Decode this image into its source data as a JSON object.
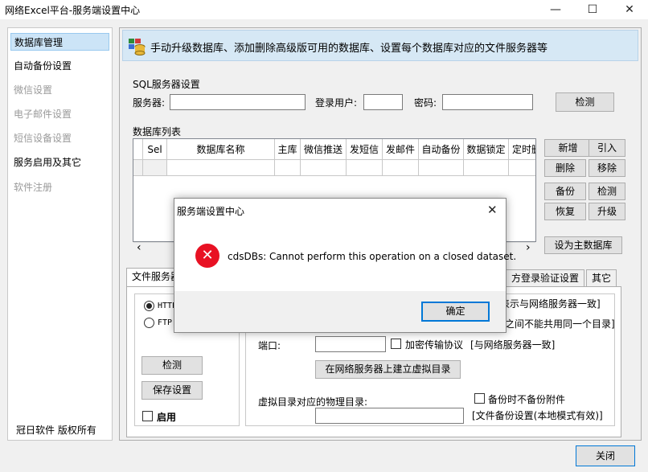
{
  "window": {
    "title": "网络Excel平台-服务端设置中心",
    "minimize": "—",
    "maximize": "☐",
    "close": "✕"
  },
  "sidebar": {
    "items": [
      {
        "label": "数据库管理",
        "state": "selected"
      },
      {
        "label": "自动备份设置",
        "state": "normal"
      },
      {
        "label": "微信设置",
        "state": "disabled"
      },
      {
        "label": "电子邮件设置",
        "state": "disabled"
      },
      {
        "label": "短信设备设置",
        "state": "disabled"
      },
      {
        "label": "服务启用及其它",
        "state": "normal"
      },
      {
        "label": "软件注册",
        "state": "disabled"
      }
    ],
    "footer": "冠日软件  版权所有"
  },
  "banner": {
    "text": "手动升级数据库、添加删除高级版可用的数据库、设置每个数据库对应的文件服务器等"
  },
  "sql": {
    "group_label": "SQL服务器设置",
    "server_label": "服务器:",
    "user_label": "登录用户:",
    "password_label": "密码:",
    "server_value": "",
    "user_value": "",
    "password_value": "",
    "check_button": "检测"
  },
  "db_list": {
    "group_label": "数据库列表",
    "columns": [
      "Sel",
      "数据库名称",
      "主库",
      "微信推送",
      "发短信",
      "发邮件",
      "自动备份",
      "数据锁定",
      "定时删"
    ],
    "buttons": {
      "add": "新增",
      "import": "引入",
      "delete": "删除",
      "remove": "移除",
      "backup": "备份",
      "check": "检测",
      "restore": "恢复",
      "upgrade": "升级",
      "set_main": "设为主数据库"
    },
    "scroll_left": "‹",
    "scroll_right": "›"
  },
  "tabs": [
    {
      "label": "文件服务器",
      "active": true
    },
    {
      "label": "方登录验证设置",
      "active": false
    },
    {
      "label": "其它",
      "active": false
    }
  ],
  "file_server": {
    "radio_http": "HTTP",
    "radio_ftp": "FTP",
    "http_hint": "表示与网络服务器一致]",
    "dir_hint": "之间不能共用同一个目录]",
    "port_label": "端口:",
    "port_value": "",
    "encrypt_label": "加密传输协议",
    "encrypt_hint": "[与网络服务器一致]",
    "create_vdir_button": "在网络服务器上建立虚拟目录",
    "phys_dir_label": "虚拟目录对应的物理目录:",
    "phys_dir_value": "",
    "no_backup_label": "备份时不备份附件",
    "backup_hint": "[文件备份设置(本地模式有效)]",
    "check_button": "检测",
    "save_button": "保存设置",
    "enable_label": "启用"
  },
  "footer_close": "关闭",
  "dialog": {
    "title": "服务端设置中心",
    "close": "✕",
    "icon": "✕",
    "message": "cdsDBs: Cannot perform this operation on a closed dataset.",
    "ok_button": "确定"
  },
  "colors": {
    "banner_bg": "#d6e8f5",
    "selection": "#cce4f7",
    "error": "#e81123",
    "focus": "#0078d7"
  }
}
